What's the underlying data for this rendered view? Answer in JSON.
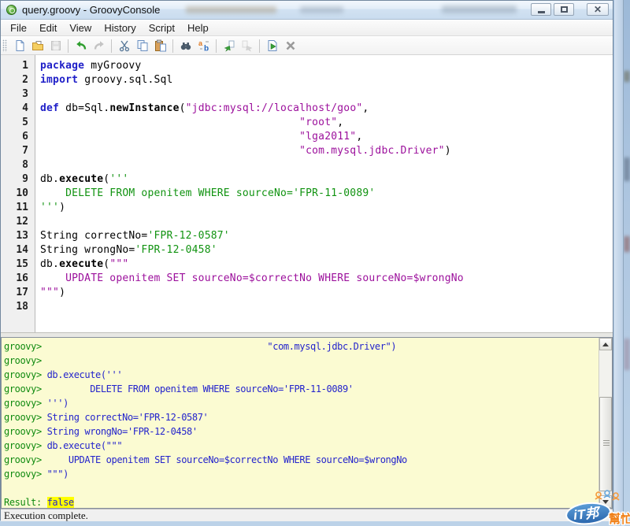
{
  "window": {
    "title": "query.groovy - GroovyConsole",
    "controls": [
      "minimize",
      "maximize",
      "close"
    ]
  },
  "menu": {
    "items": [
      "File",
      "Edit",
      "View",
      "History",
      "Script",
      "Help"
    ]
  },
  "toolbar": {
    "icons": [
      {
        "name": "new-file"
      },
      {
        "name": "open-file"
      },
      {
        "name": "save-file",
        "disabled": true,
        "sep": true
      },
      {
        "name": "undo"
      },
      {
        "name": "redo",
        "disabled": true,
        "sep": true
      },
      {
        "name": "cut"
      },
      {
        "name": "copy"
      },
      {
        "name": "paste",
        "sep": true
      },
      {
        "name": "find"
      },
      {
        "name": "replace",
        "sep": true
      },
      {
        "name": "history-previous"
      },
      {
        "name": "history-next",
        "disabled": true,
        "sep": true
      },
      {
        "name": "run-script"
      },
      {
        "name": "clear-output"
      }
    ]
  },
  "editor": {
    "lines": [
      {
        "n": 1,
        "seg": [
          [
            "k",
            "package"
          ],
          [
            "p",
            " myGroovy"
          ]
        ]
      },
      {
        "n": 2,
        "seg": [
          [
            "k",
            "import"
          ],
          [
            "p",
            " groovy.sql.Sql"
          ]
        ]
      },
      {
        "n": 3,
        "seg": []
      },
      {
        "n": 4,
        "seg": [
          [
            "k",
            "def"
          ],
          [
            "p",
            " db=Sql."
          ],
          [
            "m",
            "newInstance"
          ],
          [
            "p",
            "("
          ],
          [
            "d",
            "\"jdbc:mysql://localhost/goo\""
          ],
          [
            "p",
            ","
          ]
        ]
      },
      {
        "n": 5,
        "seg": [
          [
            "p",
            "                                         "
          ],
          [
            "d",
            "\"root\""
          ],
          [
            "p",
            ","
          ]
        ]
      },
      {
        "n": 6,
        "seg": [
          [
            "p",
            "                                         "
          ],
          [
            "d",
            "\"lga2011\""
          ],
          [
            "p",
            ","
          ]
        ]
      },
      {
        "n": 7,
        "seg": [
          [
            "p",
            "                                         "
          ],
          [
            "d",
            "\"com.mysql.jdbc.Driver\""
          ],
          [
            "p",
            ")"
          ]
        ]
      },
      {
        "n": 8,
        "seg": []
      },
      {
        "n": 9,
        "seg": [
          [
            "p",
            "db."
          ],
          [
            "m",
            "execute"
          ],
          [
            "p",
            "("
          ],
          [
            "s",
            "'''"
          ]
        ]
      },
      {
        "n": 10,
        "seg": [
          [
            "s",
            "    DELETE FROM openitem WHERE sourceNo='FPR-11-0089'"
          ]
        ]
      },
      {
        "n": 11,
        "seg": [
          [
            "s",
            "'''"
          ],
          [
            "p",
            ")"
          ]
        ]
      },
      {
        "n": 12,
        "seg": []
      },
      {
        "n": 13,
        "seg": [
          [
            "p",
            "String correctNo="
          ],
          [
            "s",
            "'FPR-12-0587'"
          ]
        ]
      },
      {
        "n": 14,
        "seg": [
          [
            "p",
            "String wrongNo="
          ],
          [
            "s",
            "'FPR-12-0458'"
          ]
        ]
      },
      {
        "n": 15,
        "seg": [
          [
            "p",
            "db."
          ],
          [
            "m",
            "execute"
          ],
          [
            "p",
            "("
          ],
          [
            "d",
            "\"\"\""
          ]
        ]
      },
      {
        "n": 16,
        "seg": [
          [
            "d",
            "    UPDATE openitem SET sourceNo=$correctNo WHERE sourceNo=$wrongNo"
          ]
        ]
      },
      {
        "n": 17,
        "seg": [
          [
            "d",
            "\"\"\""
          ],
          [
            "p",
            ")"
          ]
        ]
      },
      {
        "n": 18,
        "seg": []
      }
    ]
  },
  "output": {
    "lines": [
      {
        "seg": [
          [
            "g",
            "groovy> "
          ],
          [
            "c",
            "                                         \"com.mysql.jdbc.Driver\")"
          ]
        ]
      },
      {
        "seg": [
          [
            "g",
            "groovy> "
          ]
        ]
      },
      {
        "seg": [
          [
            "g",
            "groovy> "
          ],
          [
            "c",
            "db.execute('''"
          ]
        ]
      },
      {
        "seg": [
          [
            "g",
            "groovy> "
          ],
          [
            "c",
            "        DELETE FROM openitem WHERE sourceNo='FPR-11-0089'"
          ]
        ]
      },
      {
        "seg": [
          [
            "g",
            "groovy> "
          ],
          [
            "c",
            "''')"
          ]
        ]
      },
      {
        "seg": [
          [
            "g",
            "groovy> "
          ],
          [
            "c",
            "String correctNo='FPR-12-0587'"
          ]
        ]
      },
      {
        "seg": [
          [
            "g",
            "groovy> "
          ],
          [
            "c",
            "String wrongNo='FPR-12-0458'"
          ]
        ]
      },
      {
        "seg": [
          [
            "g",
            "groovy> "
          ],
          [
            "c",
            "db.execute(\"\"\""
          ]
        ]
      },
      {
        "seg": [
          [
            "g",
            "groovy> "
          ],
          [
            "c",
            "    UPDATE openitem SET sourceNo=$correctNo WHERE sourceNo=$wrongNo"
          ]
        ]
      },
      {
        "seg": [
          [
            "g",
            "groovy> "
          ],
          [
            "c",
            "\"\"\")"
          ]
        ]
      },
      {
        "seg": []
      },
      {
        "seg": [
          [
            "l",
            "Result: "
          ],
          [
            "r",
            "false"
          ]
        ]
      }
    ]
  },
  "statusbar": {
    "text": "Execution complete."
  },
  "watermark": {
    "badge_text": "iT邦",
    "side_text": "幫忙"
  },
  "colors": {
    "keyword": "#1f1fc8",
    "string_double": "#9c109c",
    "string_single": "#119311",
    "prompt_green": "#0f8a0f",
    "output_code": "#2424cc",
    "result_highlight": "#ffff00",
    "output_bg": "#fbfbd2"
  }
}
